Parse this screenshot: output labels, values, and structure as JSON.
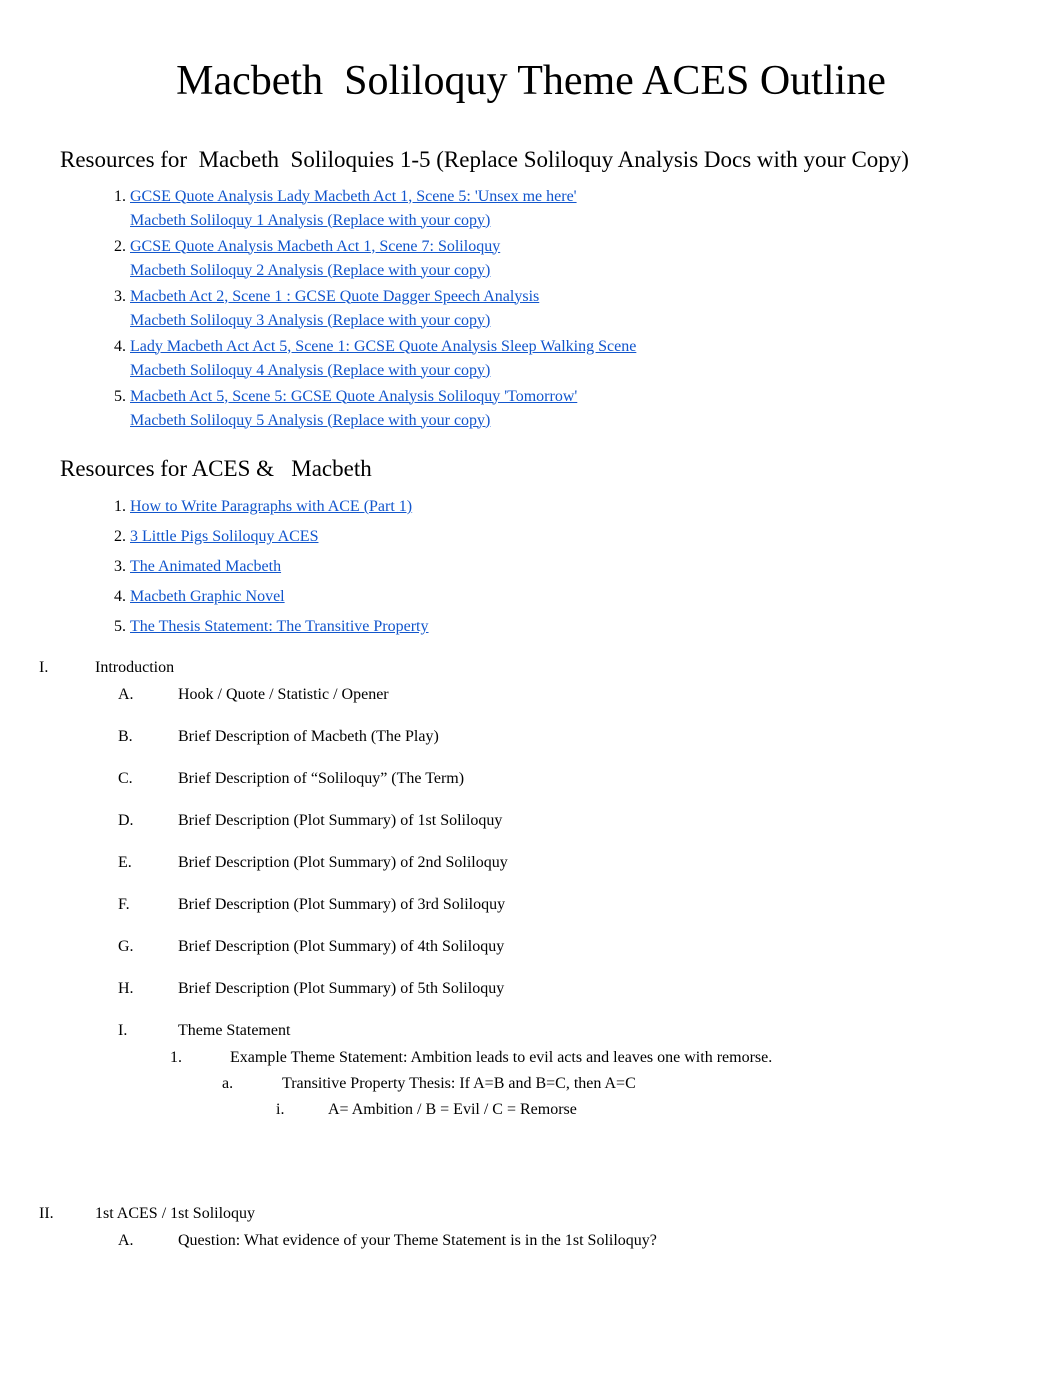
{
  "title": "Macbeth  Soliloquy Theme ACES Outline",
  "section1_heading": "Resources for  Macbeth  Soliloquies 1-5 (Replace Soliloquy Analysis Docs with your Copy)",
  "resources1": [
    {
      "line1": "GCSE Quote Analysis Lady Macbeth Act 1, Scene 5: 'Unsex me here'",
      "line2": "Macbeth Soliloquy 1 Analysis (Replace with your copy)"
    },
    {
      "line1": "GCSE Quote Analysis Macbeth Act 1, Scene 7: Soliloquy",
      "line2": "Macbeth Soliloquy 2 Analysis (Replace with your copy)"
    },
    {
      "line1": "Macbeth Act 2, Scene 1 : GCSE Quote Dagger Speech Analysis",
      "line2": "Macbeth Soliloquy 3 Analysis (Replace with your copy)"
    },
    {
      "line1": "Lady Macbeth Act Act 5, Scene 1: GCSE Quote Analysis Sleep Walking Scene",
      "line2": "Macbeth Soliloquy 4 Analysis (Replace with your copy)"
    },
    {
      "line1": "Macbeth Act 5, Scene 5: GCSE Quote Analysis Soliloquy 'Tomorrow'",
      "line2": "Macbeth Soliloquy 5 Analysis (Replace with your copy)"
    }
  ],
  "section2_heading": "Resources for ACES &   Macbeth",
  "resources2": [
    "How to Write Paragraphs with ACE (Part 1)",
    "3 Little Pigs Soliloquy ACES",
    "The Animated Macbeth",
    "Macbeth Graphic Novel",
    "The Thesis Statement: The Transitive Property"
  ],
  "outline": {
    "I_marker": "I.",
    "I_text": "Introduction",
    "A": "Hook / Quote / Statistic / Opener",
    "B": "Brief Description of Macbeth (The Play)",
    "C": "Brief Description of “Soliloquy” (The Term)",
    "D": "Brief Description (Plot Summary) of 1st Soliloquy",
    "E": "Brief Description (Plot Summary) of 2nd Soliloquy",
    "F": "Brief Description (Plot Summary) of 3rd Soliloquy",
    "G": "Brief Description (Plot Summary) of 4th Soliloquy",
    "H": "Brief Description (Plot Summary) of 5th Soliloquy",
    "ItemI": "Theme Statement",
    "I1": "Example Theme Statement: Ambition leads to evil acts and leaves one with remorse.",
    "I1a": "Transitive Property Thesis: If A=B and B=C, then A=C",
    "I1ai": "A= Ambition / B = Evil / C = Remorse",
    "II_marker": "II.",
    "II_text": "1st ACES / 1st Soliloquy",
    "IIA": "Question: What evidence of your Theme Statement is in the 1st Soliloquy?"
  },
  "markers": {
    "A": "A.",
    "B": "B.",
    "C": "C.",
    "D": "D.",
    "E": "E.",
    "F": "F.",
    "G": "G.",
    "H": "H.",
    "I": "I.",
    "n1": "1.",
    "a": "a.",
    "i": "i."
  }
}
